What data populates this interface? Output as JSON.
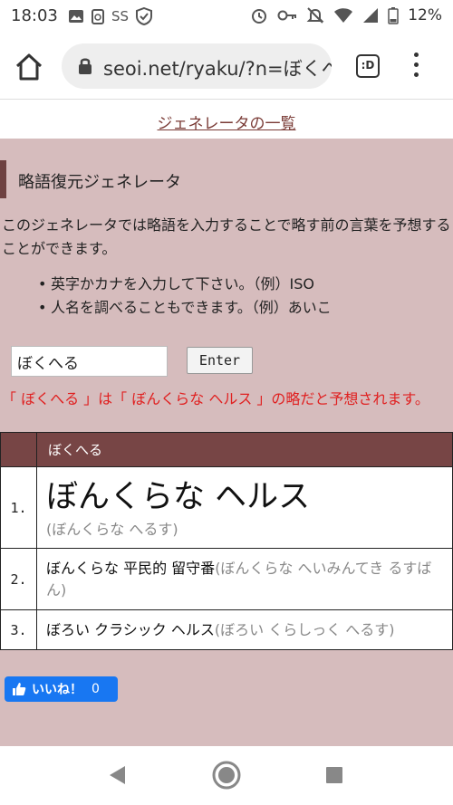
{
  "status_bar": {
    "time": "18:03",
    "left_icons": [
      "image-icon",
      "clipboard-icon",
      "sound-search-icon",
      "shield-icon"
    ],
    "right_icons": [
      "alarm-icon",
      "key-icon",
      "mute-icon",
      "wifi-icon",
      "signal-icon",
      "battery-icon"
    ],
    "battery": "12%"
  },
  "browser": {
    "url": "seoi.net/ryaku/?n=ぼくへ",
    "tab_switcher_label": ":D"
  },
  "page": {
    "top_link": "ジェネレータの一覧",
    "heading": "略語復元ジェネレータ",
    "description": "このジェネレータでは略語を入力することで略す前の言葉を予想することができます。",
    "bullets": [
      "英字かカナを入力して下さい。（例）ISO",
      "人名を調べることもできます。（例）あいこ"
    ],
    "input_value": "ぼくへる",
    "enter_label": "Enter",
    "result_message": "「 ぼくへる 」は「 ぼんくらな ヘルス 」の略だと予想されます。",
    "table": {
      "header": "ぼくへる",
      "rows": [
        {
          "num": "1.",
          "main": "ぼんくらな ヘルス",
          "reading": "(ぼんくらな へるす)"
        },
        {
          "num": "2.",
          "main": "ぼんくらな 平民的 留守番",
          "reading": "(ぼんくらな へいみんてき るすばん)"
        },
        {
          "num": "3.",
          "main": "ぼろい クラシック ヘルス",
          "reading": "(ぼろい くらしっく へるす)"
        }
      ]
    },
    "like_button": {
      "label": "いいね！",
      "count": "0"
    }
  }
}
